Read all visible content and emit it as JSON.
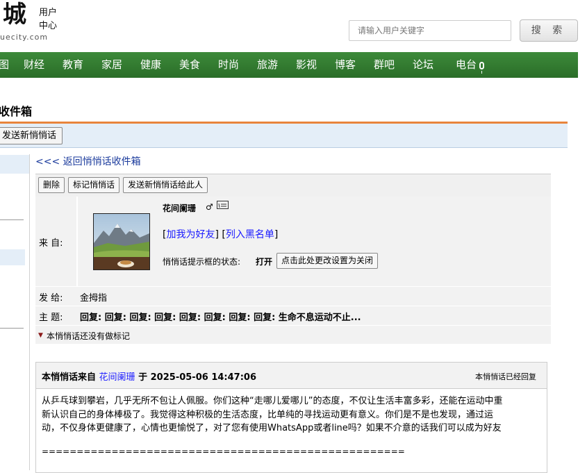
{
  "header": {
    "logo_char": "城",
    "logo_domain": "uecity.com",
    "user_center": [
      "用户",
      "中心"
    ],
    "search_placeholder": "请输入用户关键字",
    "search_button": "搜 索"
  },
  "nav": {
    "items": [
      "图",
      "财经",
      "教育",
      "家居",
      "健康",
      "美食",
      "时尚",
      "旅游",
      "影视",
      "博客",
      "群吧",
      "论坛",
      "电台"
    ],
    "mic_icon": "microphone-icon"
  },
  "page": {
    "title": "收件箱",
    "send_new": "发送新悄悄话"
  },
  "main": {
    "back_link": "<<< 返回悄悄话收件箱",
    "toolbar": [
      "删除",
      "标记悄悄话",
      "发送新悄悄话给此人"
    ],
    "from_label": "来 自:",
    "sender": {
      "name": "花间阑珊",
      "gender_icon": "male-icon",
      "add_friend": "加我为好友",
      "blacklist": "列入黑名单",
      "status_label": "悄悄话提示框的状态:",
      "status_value": "打开",
      "status_button": "点击此处更改设置为关闭"
    },
    "to_label": "发 给:",
    "to_value": "金拇指",
    "subject_label": "主 题:",
    "subject_value": "回复: 回复: 回复: 回复: 回复: 回复: 回复: 回复: 生命不息运动不止...",
    "flag_text": "本悄悄话还没有做标记"
  },
  "message": {
    "from_prefix": "本悄悄话来自",
    "from_name": "花间阑珊",
    "date_prefix": "于",
    "datetime": "2025-05-06 14:47:06",
    "status": "本悄悄话已经回复",
    "body_lines": [
      "从乒乓球到攀岩，几乎无所不包让人佩服。你们这种“走哪儿爱哪儿”的态度，不仅让生活丰富多彩，还能在运动中重",
      "新认识自己的身体棒极了。我觉得这种积极的生活态度，比单纯的寻找运动更有意义。你们是不是也发现，通过运",
      "动，不仅身体更健康了，心情也更愉悦了，对了您有使用WhatsApp或者line吗？如果不介意的话我们可以成为好友"
    ],
    "separator": "===================================================="
  }
}
